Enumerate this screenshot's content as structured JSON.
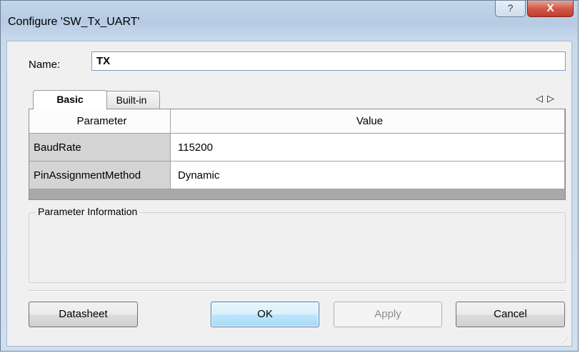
{
  "window": {
    "title": "Configure 'SW_Tx_UART'",
    "help_glyph": "?",
    "close_glyph": "X"
  },
  "name_field": {
    "label": "Name:",
    "value": "TX"
  },
  "tabs": [
    {
      "label": "Basic",
      "active": true
    },
    {
      "label": "Built-in",
      "active": false
    }
  ],
  "tab_scroll": {
    "left": "◁",
    "right": "▷"
  },
  "parameters": {
    "columns": [
      "Parameter",
      "Value"
    ],
    "rows": [
      {
        "name": "BaudRate",
        "value": "115200"
      },
      {
        "name": "PinAssignmentMethod",
        "value": "Dynamic"
      }
    ]
  },
  "info": {
    "legend": "Parameter Information"
  },
  "buttons": {
    "datasheet": "Datasheet",
    "ok": "OK",
    "apply": "Apply",
    "cancel": "Cancel"
  },
  "colors": {
    "title_bar": "#b6cbe3",
    "close_button": "#c23b2c",
    "default_button": "#bee6fd"
  }
}
